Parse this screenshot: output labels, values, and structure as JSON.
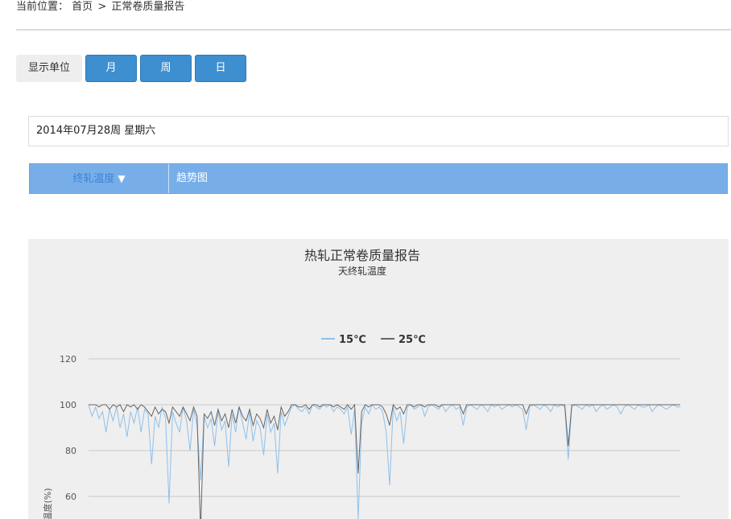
{
  "breadcrumb": {
    "prefix": "当前位置：",
    "home": "首页",
    "sep": ">",
    "current": "正常卷质量报告"
  },
  "unit": {
    "label": "显示单位",
    "buttons": [
      "月",
      "周",
      "日"
    ]
  },
  "date_text": "2014年07月28周 星期六",
  "tabs": {
    "first": "终轧温度",
    "first_icon": "triangle-down-icon",
    "second": "趋势图"
  },
  "colors": {
    "accent": "#3d8fd0",
    "tabbar": "#78aee8",
    "series15": "#8fc0ea",
    "series25": "#666666"
  },
  "chart_data": {
    "type": "line",
    "title": "热轧正常卷质量报告",
    "subtitle": "天终轧温度",
    "ylabel": "温度(%)",
    "yticks": [
      120,
      100,
      80,
      60
    ],
    "ylim": [
      40,
      120
    ],
    "grid": true,
    "legend": "top-center",
    "series": [
      {
        "name": "15℃",
        "color": "#8fc0ea",
        "values": [
          100,
          95,
          99,
          94,
          97,
          88,
          98,
          93,
          99,
          90,
          96,
          86,
          97,
          92,
          99,
          88,
          98,
          96,
          74,
          95,
          90,
          99,
          94,
          57,
          97,
          92,
          88,
          99,
          93,
          80,
          98,
          91,
          67,
          95,
          90,
          94,
          82,
          97,
          89,
          93,
          73,
          96,
          88,
          99,
          92,
          85,
          97,
          84,
          93,
          90,
          78,
          96,
          88,
          92,
          70,
          97,
          91,
          95,
          99,
          100,
          98,
          97,
          99,
          96,
          100,
          99,
          98,
          100,
          99,
          100,
          97,
          99,
          98,
          96,
          99,
          87,
          98,
          50,
          92,
          99,
          96,
          100,
          98,
          99,
          97,
          88,
          65,
          99,
          93,
          97,
          83,
          99,
          100,
          98,
          99,
          100,
          95,
          99,
          100,
          99,
          98,
          100,
          97,
          99,
          100,
          98,
          99,
          91,
          99,
          100,
          99,
          98,
          100,
          99,
          97,
          100,
          99,
          100,
          98,
          99,
          100,
          99,
          100,
          99,
          98,
          89,
          99,
          100,
          99,
          98,
          100,
          99,
          97,
          100,
          99,
          100,
          99,
          76,
          99,
          100,
          99,
          98,
          100,
          99,
          100,
          97,
          99,
          100,
          98,
          99,
          100,
          99,
          96,
          99,
          100,
          99,
          98,
          100,
          99,
          99,
          100,
          97,
          99,
          100,
          99,
          98,
          99,
          100,
          99,
          99
        ]
      },
      {
        "name": "25℃",
        "color": "#666666",
        "values": [
          100,
          100,
          100,
          99,
          100,
          100,
          98,
          100,
          99,
          100,
          97,
          100,
          99,
          100,
          98,
          100,
          99,
          97,
          95,
          99,
          96,
          98,
          97,
          92,
          99,
          97,
          95,
          99,
          96,
          93,
          99,
          95,
          45,
          96,
          94,
          97,
          91,
          98,
          93,
          96,
          90,
          98,
          92,
          99,
          95,
          93,
          98,
          91,
          96,
          94,
          90,
          98,
          92,
          95,
          89,
          99,
          95,
          97,
          100,
          100,
          99,
          99,
          100,
          98,
          100,
          100,
          99,
          100,
          100,
          100,
          99,
          100,
          99,
          98,
          100,
          98,
          100,
          70,
          97,
          100,
          99,
          100,
          100,
          100,
          99,
          96,
          91,
          100,
          98,
          99,
          96,
          100,
          100,
          99,
          100,
          100,
          99,
          100,
          100,
          100,
          99,
          100,
          100,
          100,
          100,
          100,
          100,
          96,
          100,
          100,
          100,
          100,
          100,
          100,
          100,
          100,
          100,
          100,
          100,
          100,
          100,
          100,
          100,
          100,
          100,
          96,
          100,
          100,
          100,
          100,
          100,
          100,
          100,
          100,
          100,
          100,
          100,
          82,
          100,
          100,
          100,
          100,
          100,
          100,
          100,
          100,
          100,
          100,
          100,
          100,
          100,
          100,
          100,
          100,
          100,
          100,
          100,
          100,
          100,
          100,
          100,
          100,
          100,
          100,
          100,
          100,
          100,
          100,
          100,
          100
        ]
      }
    ]
  }
}
